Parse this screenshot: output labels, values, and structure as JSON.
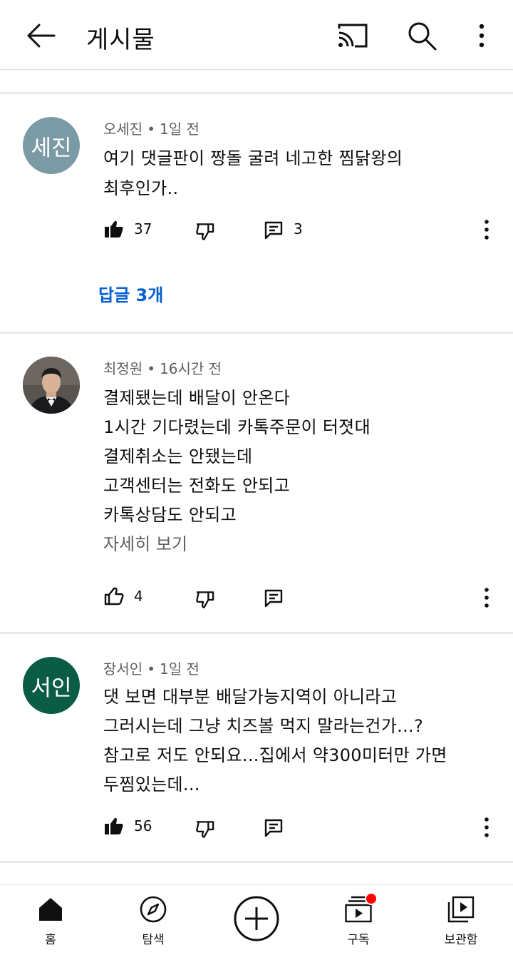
{
  "header": {
    "title": "게시물"
  },
  "comments": [
    {
      "avatar_text": "세진",
      "avatar_color": "#7a9aa5",
      "author": "오세진",
      "time": "1일 전",
      "lines": [
        "여기 댓글판이 짱돌 굴려 네고한 찜닭왕의",
        "최후인가.."
      ],
      "likes": "37",
      "liked": true,
      "reply_count": "3",
      "replies_link": "답글 3개"
    },
    {
      "avatar_text": "",
      "avatar_color": "#3b3a38",
      "author": "최정원",
      "time": "16시간 전",
      "lines": [
        "결제됐는데 배달이 안온다",
        "1시간 기다렸는데 카톡주문이 터졋대",
        "결제취소는 안됐는데",
        "고객센터는 전화도 안되고",
        "카톡상담도 안되고"
      ],
      "read_more": "자세히 보기",
      "likes": "4",
      "liked": false
    },
    {
      "avatar_text": "서인",
      "avatar_color": "#0a5c45",
      "author": "장서인",
      "time": "1일 전",
      "lines": [
        "댓 보면 대부분 배달가능지역이 아니라고",
        "그러시는데 그냥 치즈볼 먹지 말라는건가...?",
        "참고로 저도 안되요...집에서 약300미터만 가면",
        "두찜있는데..."
      ],
      "likes": "56",
      "liked": true
    }
  ],
  "bottom_nav": [
    {
      "label": "홈",
      "icon": "home-icon"
    },
    {
      "label": "탐색",
      "icon": "compass-icon"
    },
    {
      "label": "",
      "icon": "create-plus-icon"
    },
    {
      "label": "구독",
      "icon": "subscriptions-icon"
    },
    {
      "label": "보관함",
      "icon": "library-icon"
    }
  ],
  "colors": {
    "link": "#065fd4",
    "meta": "#606060",
    "notification_dot": "#ff0000"
  }
}
